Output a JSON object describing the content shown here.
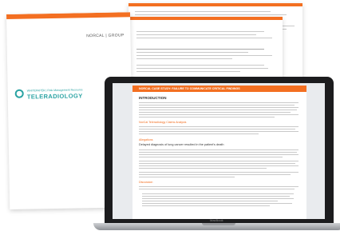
{
  "cover": {
    "brand": "NORCAL | GROUP",
    "whitepaper_label": "WHITEPAPER | Risk Management Resource",
    "title": "TELERADIOLOGY",
    "footer_brand": "NORCAL"
  },
  "back_page": {
    "footer_brand": "NORCAL"
  },
  "laptop": {
    "brand_label": "MacBook",
    "doc_header": "NORCAL CASE STUDY: FAILURE TO COMMUNICATE CRITICAL FINDINGS",
    "heading_intro": "INTRODUCTION",
    "subheading_1": "NorCal Teleradiology Claims Analysis",
    "subheading_2": "Allegations",
    "allegation_text": "Delayed diagnosis of lung cancer resulted in the patient's death",
    "subheading_3": "Discussion"
  },
  "colors": {
    "accent": "#f36f21",
    "teal": "#2aa3a3"
  }
}
